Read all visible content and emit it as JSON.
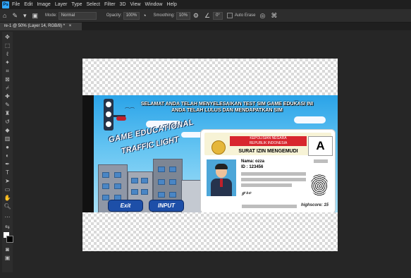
{
  "menubar": {
    "logo": "Ps",
    "items": [
      "File",
      "Edit",
      "Image",
      "Layer",
      "Type",
      "Select",
      "Filter",
      "3D",
      "View",
      "Window",
      "Help"
    ]
  },
  "options_bar": {
    "mode_label": "Mode:",
    "mode_value": "Normal",
    "opacity_label": "Opacity:",
    "opacity_value": "100%",
    "smoothing_label": "Smoothing:",
    "smoothing_value": "10%",
    "angle_value": "0°",
    "auto_erase_label": "Auto Erase"
  },
  "document_tab": {
    "title": " re-1 @ 50% (Layer 14, RGB/8) *",
    "close": "×"
  },
  "game": {
    "banner_line1": "SELAMAT ANDA TELAH MENYELESAIKAN TEST SIM GAME EDUKASI INI",
    "banner_line2": "ANDA TELAH LULUS DAN MENDAPATKAN SIM",
    "title_line1": "GAME EDUCATIONAL",
    "title_line2": "TRAFFIC LIGHT",
    "exit_button": "Exit",
    "input_button": "INPUT"
  },
  "license": {
    "authority_line1": "KEPOLISIAN NEGARA",
    "authority_line2": "REPUBLIK INDONESIA",
    "card_title": "SURAT IZIN MENGEMUDI",
    "grade": "A",
    "name": "Nama: ozza",
    "id": "ID : 123456",
    "stamp": "highscore: 15"
  },
  "colors": {
    "ui_bg": "#262626",
    "panel": "#2d2d2d",
    "accent": "#31a8ff",
    "button": "#1d4fa8",
    "red_band": "#d8262e"
  }
}
